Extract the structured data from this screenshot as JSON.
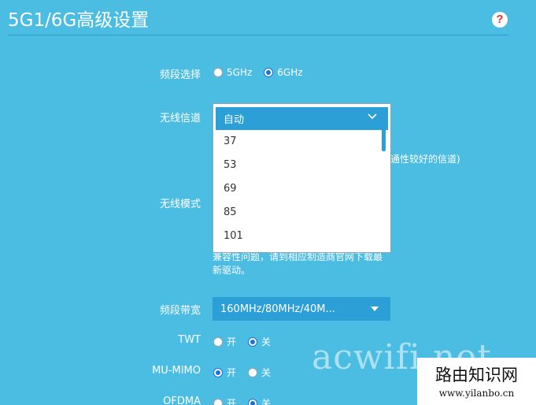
{
  "page": {
    "title": "5G1/6G高级设置",
    "help": "?"
  },
  "band": {
    "label": "频段选择",
    "options": [
      "5GHz",
      "6GHz"
    ],
    "selected": "6GHz"
  },
  "channel": {
    "label": "无线信道",
    "selected": "自动",
    "options": [
      "37",
      "53",
      "69",
      "85",
      "101"
    ],
    "hint_fragment": "通性较好的信道)"
  },
  "mode": {
    "label": "无线模式",
    "hint_line1": "兼容性问题，请到相应制造商官网下载最",
    "hint_line2": "新驱动。"
  },
  "bandwidth": {
    "label": "频段带宽",
    "value": "160MHz/80MHz/40M..."
  },
  "twt": {
    "label": "TWT",
    "on": "开",
    "off": "关",
    "selected": "关"
  },
  "mumimo": {
    "label": "MU-MIMO",
    "on": "开",
    "off": "关",
    "selected": "开"
  },
  "ofdma": {
    "label": "OFDMA",
    "on": "开",
    "off": "关",
    "selected": "关"
  },
  "watermark": {
    "text": "acwifi.net"
  },
  "logo": {
    "name": "路由知识网",
    "url": "www.yilanbo.cn"
  },
  "colors": {
    "background": "#4bbde2",
    "accent": "#2c9fd6",
    "radio": "#1c6fd6"
  }
}
